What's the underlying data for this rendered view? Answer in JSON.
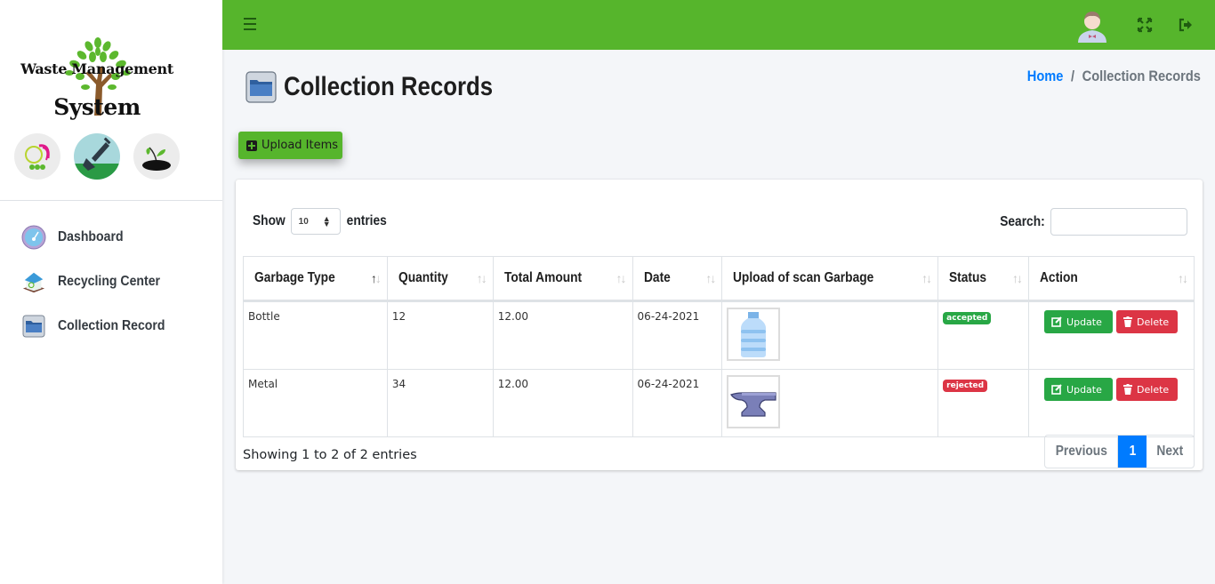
{
  "brand": {
    "line1": "Waste Management",
    "line2": "System"
  },
  "sidebar": {
    "items": [
      {
        "label": "Dashboard",
        "icon": "dashboard-gauge-icon"
      },
      {
        "label": "Recycling Center",
        "icon": "recycling-house-icon"
      },
      {
        "label": "Collection Record",
        "icon": "folder-icon"
      }
    ]
  },
  "topbar": {
    "menu_icon": "hamburger-icon",
    "avatar_icon": "user-avatar",
    "fullscreen_icon": "expand-icon",
    "logout_icon": "logout-icon"
  },
  "page": {
    "title": "Collection Records",
    "breadcrumb": {
      "home": "Home",
      "separator": "/",
      "current": "Collection Records"
    },
    "upload_button": "Upload Items"
  },
  "table_controls": {
    "show_label": "Show",
    "entries_label": "entries",
    "page_length": "10",
    "search_label": "Search:",
    "search_value": ""
  },
  "table": {
    "columns": [
      "Garbage Type",
      "Quantity",
      "Total Amount",
      "Date",
      "Upload of scan Garbage",
      "Status",
      "Action"
    ],
    "rows": [
      {
        "garbage_type": "Bottle",
        "quantity": "12",
        "total_amount": "12.00",
        "date": "06-24-2021",
        "image": "bottle-image",
        "status": "accepted"
      },
      {
        "garbage_type": "Metal",
        "quantity": "34",
        "total_amount": "12.00",
        "date": "06-24-2021",
        "image": "anvil-image",
        "status": "rejected"
      }
    ],
    "update_label": "Update",
    "delete_label": "Delete"
  },
  "footer": {
    "info": "Showing 1 to 2 of 2 entries",
    "previous": "Previous",
    "current_page": "1",
    "next": "Next"
  },
  "colors": {
    "brand_green": "#56b52c",
    "primary_blue": "#007bff",
    "success": "#28a745",
    "danger": "#dc3545"
  }
}
